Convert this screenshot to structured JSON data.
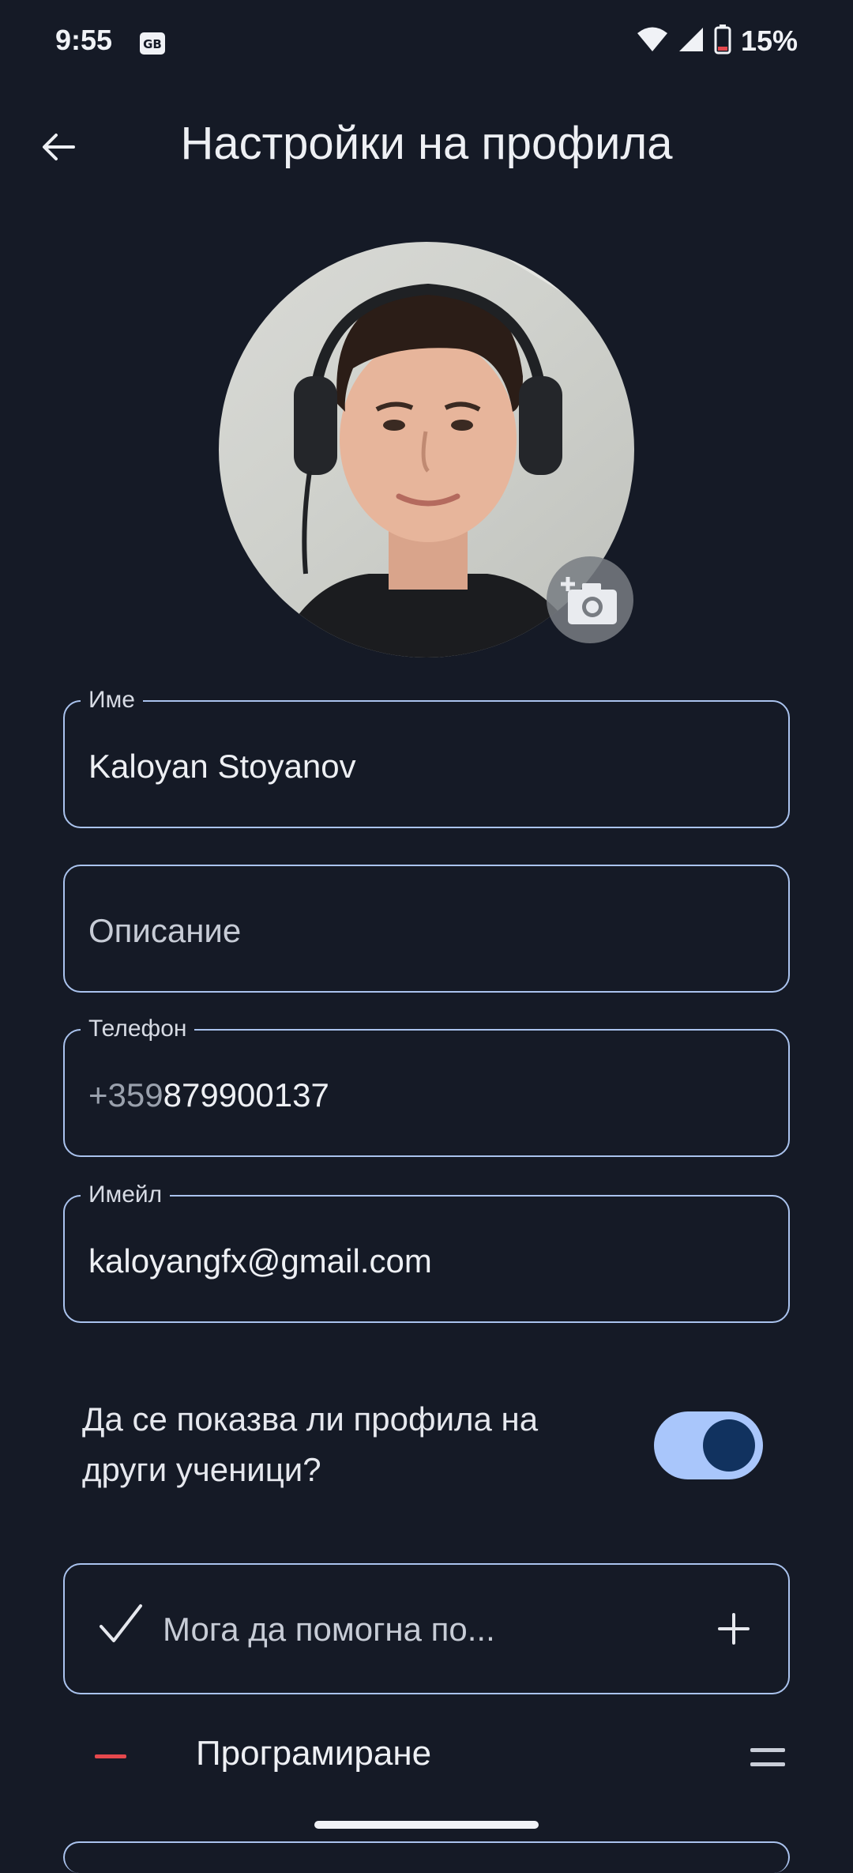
{
  "status_bar": {
    "time": "9:55",
    "battery": "15%",
    "icons": [
      "gb-app-icon",
      "wifi-icon",
      "signal-icon",
      "battery-icon"
    ]
  },
  "app_bar": {
    "title": "Настройки на профила",
    "back_icon": "arrow-left-icon"
  },
  "avatar": {
    "camera_icon": "add-camera-icon"
  },
  "fields": {
    "name": {
      "label": "Име",
      "value": "Kaloyan Stoyanov"
    },
    "description": {
      "placeholder": "Описание"
    },
    "phone": {
      "label": "Телефон",
      "prefix": "+359",
      "value": "879900137"
    },
    "email": {
      "label": "Имейл",
      "value": "kaloyangfx@gmail.com"
    }
  },
  "visibility": {
    "question": "Да се показва ли профила на други ученици?",
    "enabled": true
  },
  "subjects": {
    "placeholder": "Мога да помогна по...",
    "items": [
      {
        "label": "Програмиране"
      }
    ]
  },
  "colors": {
    "background": "#151a26",
    "outline": "#aac3ee",
    "switch_track": "#a9c6fb",
    "switch_knob": "#11325f",
    "remove": "#e5484d"
  }
}
